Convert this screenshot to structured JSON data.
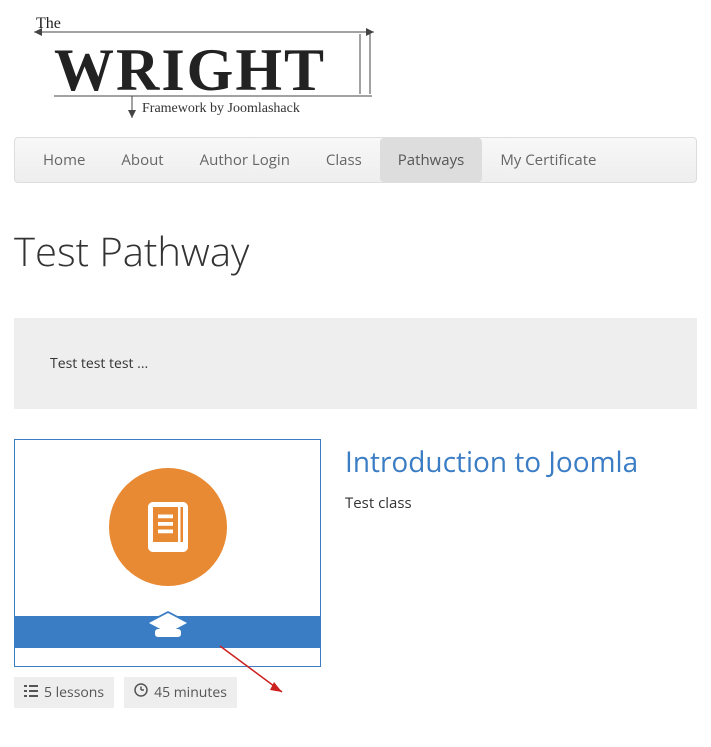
{
  "logo": {
    "text_the": "The",
    "text_main": "WRIGHT",
    "text_sub": "Framework by Joomlashack"
  },
  "nav": {
    "home": "Home",
    "about": "About",
    "author_login": "Author Login",
    "class": "Class",
    "pathways": "Pathways",
    "my_certificate": "My Certificate"
  },
  "page_title": "Test Pathway",
  "description": "Test test test ...",
  "course": {
    "title": "Introduction to Joomla",
    "description": "Test class"
  },
  "badges": {
    "lessons": "5 lessons",
    "duration": "45 minutes"
  }
}
